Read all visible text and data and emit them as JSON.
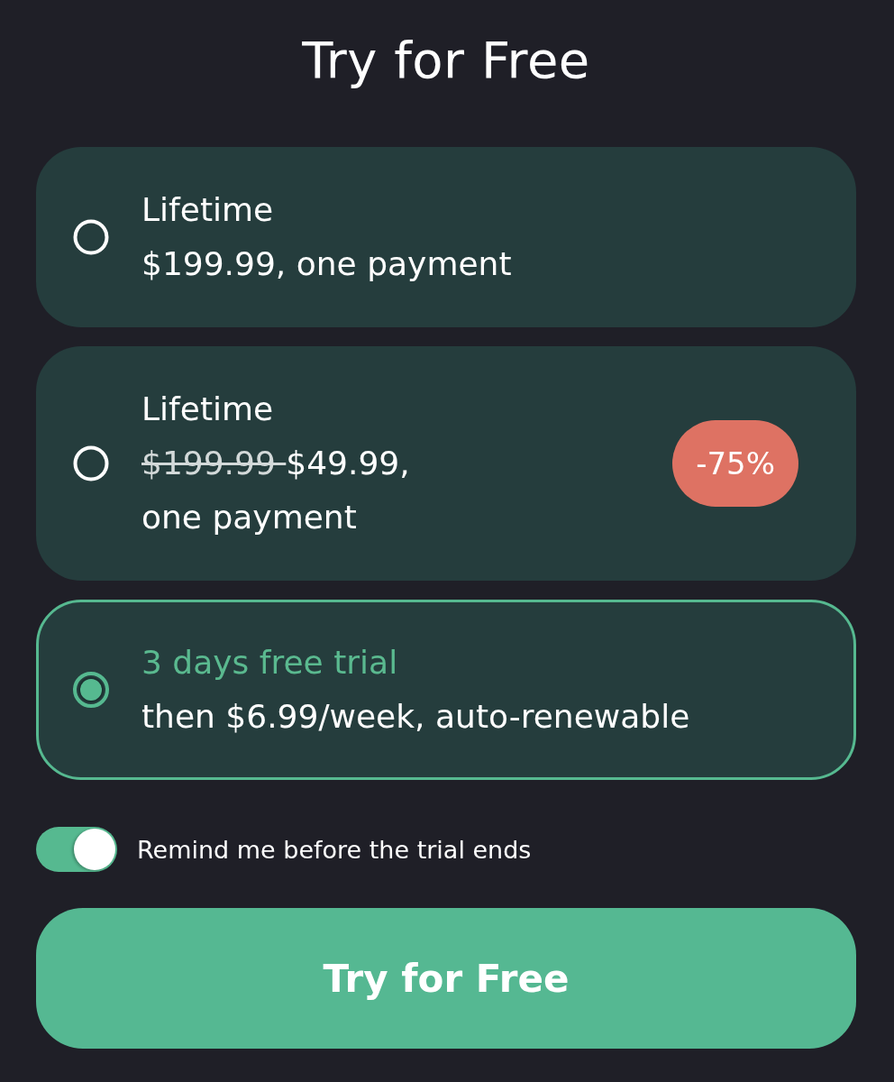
{
  "title": "Try for Free",
  "plans": [
    {
      "name": "Lifetime",
      "price": "$199.99, one payment",
      "selected": false
    },
    {
      "name": "Lifetime",
      "old_price": "$199.99",
      "price": "$49.99, one payment",
      "badge": "-75%",
      "selected": false
    },
    {
      "name": "3 days free trial",
      "price": "then $6.99/week, auto-renewable",
      "selected": true
    }
  ],
  "reminder": {
    "label": "Remind me before the trial ends",
    "on": true
  },
  "cta_button": {
    "label": "Try for Free"
  }
}
